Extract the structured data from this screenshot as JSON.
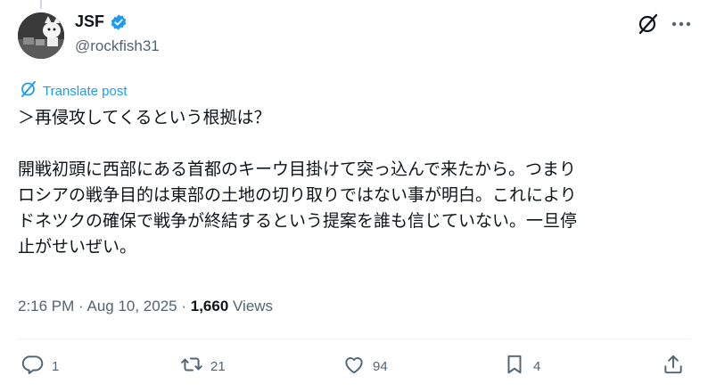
{
  "author": {
    "display_name": "JSF",
    "handle": "@rockfish31",
    "verified": true
  },
  "translate_label": "Translate post",
  "tweet": {
    "lines": [
      "＞再侵攻してくるという根拠は？",
      "",
      "開戦初頭に西部にある首都のキーウ目掛けて突っ込んで来たから。つまり",
      "ロシアの戦争目的は東部の土地の切り取りではない事が明白。これにより",
      "ドネツクの確保で戦争が終結するという提案を誰も信じていない。一旦停",
      "止がせいぜい。"
    ]
  },
  "meta": {
    "time": "2:16 PM",
    "separator": " · ",
    "date": "Aug 10, 2025",
    "views_count": "1,660",
    "views_label": " Views"
  },
  "actions": {
    "replies": "1",
    "reposts": "21",
    "likes": "94",
    "bookmarks": "4"
  },
  "icons": {
    "verified": "verified-badge-icon",
    "grok": "grok-icon",
    "more": "more-dots-icon",
    "reply": "reply-icon",
    "repost": "repost-icon",
    "like": "heart-icon",
    "bookmark": "bookmark-icon",
    "share": "share-icon"
  },
  "colors": {
    "accent": "#1d9bf0",
    "text": "#0f1419",
    "muted": "#536471"
  }
}
